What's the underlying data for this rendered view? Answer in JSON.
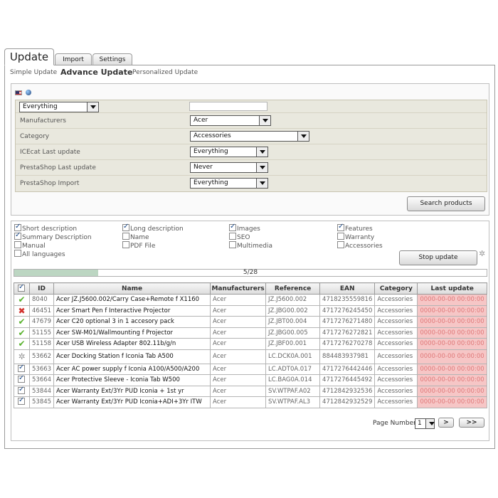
{
  "tabs": [
    {
      "label": "Update"
    },
    {
      "label": "Import"
    },
    {
      "label": "Settings"
    }
  ],
  "subnav": [
    {
      "label": "Simple Update"
    },
    {
      "label": "Advance Update"
    },
    {
      "label": "Personalized Update"
    }
  ],
  "filters": {
    "scope": {
      "value": "Everything"
    },
    "search": {
      "value": ""
    },
    "rows": [
      {
        "label": "Manufacturers",
        "value": "Acer"
      },
      {
        "label": "Category",
        "value": "Accessories"
      },
      {
        "label": "ICEcat Last update",
        "value": "Everything"
      },
      {
        "label": "PrestaShop Last update",
        "value": "Never"
      },
      {
        "label": "PrestaShop Import",
        "value": "Everything"
      }
    ],
    "search_button": "Search products"
  },
  "options": [
    {
      "label": "Short description",
      "checked": true
    },
    {
      "label": "Long description",
      "checked": true
    },
    {
      "label": "Images",
      "checked": true
    },
    {
      "label": "Features",
      "checked": true
    },
    {
      "label": "Summary Description",
      "checked": true
    },
    {
      "label": "Name",
      "checked": false
    },
    {
      "label": "SEO",
      "checked": false
    },
    {
      "label": "Warranty",
      "checked": false
    },
    {
      "label": "Manual",
      "checked": false
    },
    {
      "label": "PDF File",
      "checked": false
    },
    {
      "label": "Multimedia",
      "checked": false
    },
    {
      "label": "Accessories",
      "checked": false
    },
    {
      "label": "All languages",
      "checked": false
    }
  ],
  "stop_button": "Stop update",
  "progress": {
    "text": "5/28",
    "fraction": 0.178
  },
  "table": {
    "headers": [
      "ID",
      "Name",
      "Manufacturers",
      "Reference",
      "EAN",
      "Category",
      "Last update"
    ],
    "rows": [
      {
        "status": "ok",
        "id": "8040",
        "name": "Acer JZ.J5600.002/Carry Case+Remote f X1160",
        "manufacturer": "Acer",
        "reference": "JZ.J5600.002",
        "ean": "4718235559816",
        "category": "Accessories",
        "last_update": "0000-00-00 00:00:00"
      },
      {
        "status": "error",
        "id": "46451",
        "name": "Acer Smart Pen f Interactive Projector",
        "manufacturer": "Acer",
        "reference": "JZ.JBG00.002",
        "ean": "4717276245450",
        "category": "Accessories",
        "last_update": "0000-00-00 00:00:00"
      },
      {
        "status": "ok",
        "id": "47679",
        "name": "Acer C20 optional 3 in 1 accesory pack",
        "manufacturer": "Acer",
        "reference": "JZ.JBT00.004",
        "ean": "4717276271480",
        "category": "Accessories",
        "last_update": "0000-00-00 00:00:00"
      },
      {
        "status": "ok",
        "id": "51155",
        "name": "Acer SW-M01/Wallmounting f Projector",
        "manufacturer": "Acer",
        "reference": "JZ.JBG00.005",
        "ean": "4717276272821",
        "category": "Accessories",
        "last_update": "0000-00-00 00:00:00"
      },
      {
        "status": "ok",
        "id": "51158",
        "name": "Acer USB Wireless Adapter 802.11b/g/n",
        "manufacturer": "Acer",
        "reference": "JZ.JBF00.001",
        "ean": "4717276270278",
        "category": "Accessories",
        "last_update": "0000-00-00 00:00:00"
      },
      {
        "status": "loading",
        "id": "53662",
        "name": "Acer Docking Station f Iconia Tab A500",
        "manufacturer": "Acer",
        "reference": "LC.DCK0A.001",
        "ean": "884483937981",
        "category": "Accessories",
        "last_update": "0000-00-00 00:00:00"
      },
      {
        "status": "checked",
        "id": "53663",
        "name": "Acer AC power supply f Iconia A100/A500/A200",
        "manufacturer": "Acer",
        "reference": "LC.ADT0A.017",
        "ean": "4717276442446",
        "category": "Accessories",
        "last_update": "0000-00-00 00:00:00"
      },
      {
        "status": "checked",
        "id": "53664",
        "name": "Acer Protective Sleeve - Iconia Tab W500",
        "manufacturer": "Acer",
        "reference": "LC.BAG0A.014",
        "ean": "4717276445492",
        "category": "Accessories",
        "last_update": "0000-00-00 00:00:00"
      },
      {
        "status": "checked",
        "id": "53844",
        "name": "Acer Warranty Ext/3Yr PUD Iconia + 1st yr",
        "manufacturer": "Acer",
        "reference": "SV.WTPAF.A02",
        "ean": "4712842932536",
        "category": "Accessories",
        "last_update": "0000-00-00 00:00:00"
      },
      {
        "status": "checked",
        "id": "53845",
        "name": "Acer Warranty Ext/3Yr PUD Iconia+ADI+3Yr ITW",
        "manufacturer": "Acer",
        "reference": "SV.WTPAF.AL3",
        "ean": "4712842932529",
        "category": "Accessories",
        "last_update": "0000-00-00 00:00:00"
      }
    ]
  },
  "pager": {
    "label": "Page Number:",
    "page": "1",
    "next": ">",
    "last": ">>"
  }
}
